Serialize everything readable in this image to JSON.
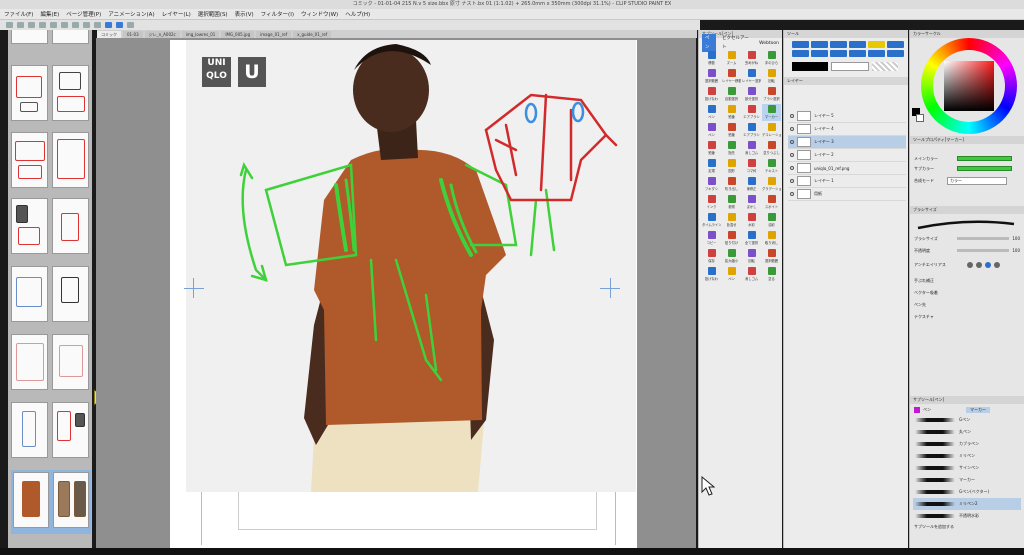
{
  "window": {
    "title": "コミック - 01-01-04 215 N.v 5 size.bbx 原寸 ナスト.bx 01 (1:1.02) + 265.0mm x 350mm (300dpi 31.1%) - CLIP STUDIO PAINT EX"
  },
  "menu": [
    "ファイル(F)",
    "編集(E)",
    "ページ管理(P)",
    "アニメーション(A)",
    "レイヤー(L)",
    "選択範囲(S)",
    "表示(V)",
    "フィルター(I)",
    "ウィンドウ(W)",
    "ヘルプ(H)"
  ],
  "tabs": [
    "コミック",
    "01-03",
    "ジレ_n_A002c",
    "img_lowres_01",
    "IMG_005.jpg",
    "image_01_ref",
    "x_guide_01_ref"
  ],
  "pages": [
    {
      "left": "11",
      "right": "10"
    },
    {
      "left": "13",
      "right": "12"
    },
    {
      "left": "15",
      "right": "14"
    },
    {
      "left": "17",
      "right": "16"
    },
    {
      "left": "19",
      "right": "18"
    },
    {
      "left": "21",
      "right": "20"
    },
    {
      "left": "23",
      "right": "22"
    },
    {
      "left": "25",
      "right": "24"
    }
  ],
  "canvas": {
    "logo_text": "UNI\nQLO",
    "logo_letter": "U"
  },
  "tool_panel": {
    "header": "サブツール[ペン]",
    "tabs": [
      "ペン",
      "ピクセルアート",
      "Webtoon"
    ],
    "tools": [
      "移動",
      "ズーム",
      "虫めがね",
      "手のひら",
      "選択範囲",
      "レイヤー移動",
      "レイヤー選択",
      "回転",
      "投げなわ",
      "自動選択",
      "部分選択",
      "ブラシ選択",
      "ペン",
      "鉛筆",
      "エアブラシ",
      "マーカー",
      "ペン",
      "鉛筆",
      "エアブラシ",
      "デコレーション",
      "鉛筆",
      "指先",
      "消しゴム",
      "塗りつぶし",
      "定規",
      "図形",
      "コマ枠",
      "テキスト",
      "フキダシ",
      "吹き出し",
      "線修正",
      "グラデーション",
      "インク",
      "参照",
      "ぼかし",
      "スポイト",
      "タイムライン",
      "色混ぜ",
      "水彩",
      "油彩",
      "コピー",
      "貼り付け",
      "全て選択",
      "取り消し",
      "保存",
      "拡大縮小",
      "回転",
      "選択範囲",
      "投げなわ",
      "ペン",
      "消しゴム",
      "塗る"
    ]
  },
  "layer_panel": {
    "header": "レイヤー",
    "layers": [
      {
        "name": "レイヤー 5",
        "selected": false
      },
      {
        "name": "レイヤー 4",
        "selected": false
      },
      {
        "name": "レイヤー 3",
        "selected": true
      },
      {
        "name": "レイヤー 2",
        "selected": false
      },
      {
        "name": "uniqlo_01_ref.png",
        "selected": false
      },
      {
        "name": "レイヤー 1",
        "selected": false
      },
      {
        "name": "用紙",
        "selected": false
      }
    ]
  },
  "right_panel": {
    "color_header": "カラーサークル",
    "props_header": "ツールプロパティ[マーカー]",
    "props": [
      {
        "label": "メインカラー",
        "value": ""
      },
      {
        "label": "サブカラー",
        "value": ""
      },
      {
        "label": "合成モード",
        "value": "カラー"
      }
    ],
    "brush_header": "ブラシサイズ",
    "brush_size_label": "ブラシサイズ",
    "brush_size_value": "100",
    "opacity_label": "不透明度",
    "opacity_value": "100",
    "aa_label": "アンチエイリアス",
    "settings": [
      "手ぶれ補正",
      "ベクター吸着",
      "ペン先",
      "テクスチャ"
    ],
    "subtool_header": "サブツール[ペン]",
    "subtool_tabs": [
      "ペン",
      "マーカー"
    ],
    "brushes": [
      {
        "name": "Gペン",
        "selected": false
      },
      {
        "name": "丸ペン",
        "selected": false
      },
      {
        "name": "カブラペン",
        "selected": false
      },
      {
        "name": "ミリペン",
        "selected": false
      },
      {
        "name": "サインペン",
        "selected": false
      },
      {
        "name": "マーカー",
        "selected": false
      },
      {
        "name": "Gペン(ベクター)",
        "selected": false
      },
      {
        "name": "ミリペン2",
        "selected": true
      },
      {
        "name": "不透明水彩",
        "selected": false
      }
    ],
    "footer": "サブツールを追加する"
  },
  "colors": {
    "sketch_green": "#3fd13a",
    "sketch_red": "#d22a2a",
    "sketch_blue": "#3a8fe0",
    "shirt": "#b0592b",
    "skin": "#4a2c1f",
    "pants": "#ede1c2",
    "accent": "#3b7bd8"
  }
}
